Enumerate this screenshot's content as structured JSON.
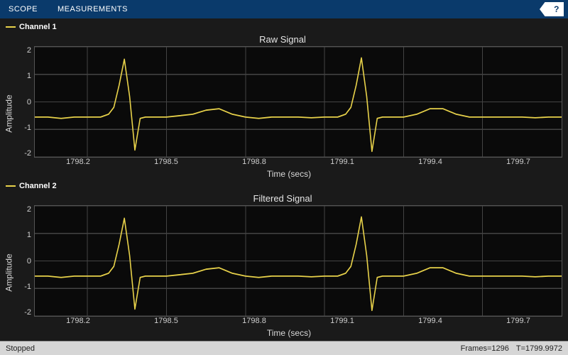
{
  "toolstrip": {
    "tabs": [
      "SCOPE",
      "MEASUREMENTS"
    ],
    "help_tooltip": "?"
  },
  "plots": [
    {
      "legend": "Channel 1",
      "title": "Raw Signal",
      "ylabel": "Amplitude",
      "xlabel": "Time (secs)"
    },
    {
      "legend": "Channel 2",
      "title": "Filtered Signal",
      "ylabel": "Amplitude",
      "xlabel": "Time (secs)"
    }
  ],
  "status": {
    "state": "Stopped",
    "frames": "Frames=1296",
    "time": "T=1799.9972"
  },
  "colors": {
    "signal": "#e8d24a",
    "toolstrip": "#0a3a6b",
    "axes_bg": "#0a0a0a"
  },
  "chart_data": [
    {
      "type": "line",
      "title": "Raw Signal",
      "xlabel": "Time (secs)",
      "ylabel": "Amplitude",
      "xlim": [
        1798.0,
        1800.0
      ],
      "ylim": [
        -2,
        2
      ],
      "xticks": [
        1798.2,
        1798.5,
        1798.8,
        1799.1,
        1799.4,
        1799.7
      ],
      "yticks": [
        -2,
        -1,
        0,
        1,
        2
      ],
      "series": [
        {
          "name": "Channel 1",
          "color": "#e8d24a",
          "x": [
            1798.0,
            1798.05,
            1798.1,
            1798.15,
            1798.2,
            1798.25,
            1798.28,
            1798.3,
            1798.32,
            1798.34,
            1798.36,
            1798.38,
            1798.4,
            1798.42,
            1798.45,
            1798.5,
            1798.55,
            1798.6,
            1798.65,
            1798.7,
            1798.75,
            1798.8,
            1798.85,
            1798.9,
            1798.95,
            1799.0,
            1799.05,
            1799.1,
            1799.15,
            1799.18,
            1799.2,
            1799.22,
            1799.24,
            1799.26,
            1799.28,
            1799.3,
            1799.32,
            1799.35,
            1799.4,
            1799.45,
            1799.5,
            1799.55,
            1799.6,
            1799.65,
            1799.7,
            1799.75,
            1799.8,
            1799.85,
            1799.9,
            1799.95,
            1800.0
          ],
          "y": [
            -0.55,
            -0.55,
            -0.6,
            -0.55,
            -0.55,
            -0.55,
            -0.45,
            -0.2,
            0.6,
            1.55,
            0.2,
            -1.75,
            -0.6,
            -0.55,
            -0.55,
            -0.55,
            -0.5,
            -0.45,
            -0.3,
            -0.25,
            -0.45,
            -0.55,
            -0.6,
            -0.55,
            -0.55,
            -0.55,
            -0.58,
            -0.55,
            -0.55,
            -0.45,
            -0.2,
            0.6,
            1.6,
            0.2,
            -1.8,
            -0.6,
            -0.55,
            -0.55,
            -0.55,
            -0.45,
            -0.25,
            -0.25,
            -0.45,
            -0.55,
            -0.55,
            -0.55,
            -0.55,
            -0.55,
            -0.58,
            -0.55,
            -0.55
          ]
        }
      ]
    },
    {
      "type": "line",
      "title": "Filtered Signal",
      "xlabel": "Time (secs)",
      "ylabel": "Amplitude",
      "xlim": [
        1798.0,
        1800.0
      ],
      "ylim": [
        -2,
        2
      ],
      "xticks": [
        1798.2,
        1798.5,
        1798.8,
        1799.1,
        1799.4,
        1799.7
      ],
      "yticks": [
        -2,
        -1,
        0,
        1,
        2
      ],
      "series": [
        {
          "name": "Channel 2",
          "color": "#e8d24a",
          "x": [
            1798.0,
            1798.05,
            1798.1,
            1798.15,
            1798.2,
            1798.25,
            1798.28,
            1798.3,
            1798.32,
            1798.34,
            1798.36,
            1798.38,
            1798.4,
            1798.42,
            1798.45,
            1798.5,
            1798.55,
            1798.6,
            1798.65,
            1798.7,
            1798.75,
            1798.8,
            1798.85,
            1798.9,
            1798.95,
            1799.0,
            1799.05,
            1799.1,
            1799.15,
            1799.18,
            1799.2,
            1799.22,
            1799.24,
            1799.26,
            1799.28,
            1799.3,
            1799.32,
            1799.35,
            1799.4,
            1799.45,
            1799.5,
            1799.55,
            1799.6,
            1799.65,
            1799.7,
            1799.75,
            1799.8,
            1799.85,
            1799.9,
            1799.95,
            1800.0
          ],
          "y": [
            -0.55,
            -0.55,
            -0.6,
            -0.55,
            -0.55,
            -0.55,
            -0.45,
            -0.2,
            0.6,
            1.55,
            0.2,
            -1.75,
            -0.6,
            -0.55,
            -0.55,
            -0.55,
            -0.5,
            -0.45,
            -0.3,
            -0.25,
            -0.45,
            -0.55,
            -0.6,
            -0.55,
            -0.55,
            -0.55,
            -0.58,
            -0.55,
            -0.55,
            -0.45,
            -0.2,
            0.6,
            1.6,
            0.2,
            -1.8,
            -0.6,
            -0.55,
            -0.55,
            -0.55,
            -0.45,
            -0.25,
            -0.25,
            -0.45,
            -0.55,
            -0.55,
            -0.55,
            -0.55,
            -0.55,
            -0.58,
            -0.55,
            -0.55
          ]
        }
      ]
    }
  ]
}
